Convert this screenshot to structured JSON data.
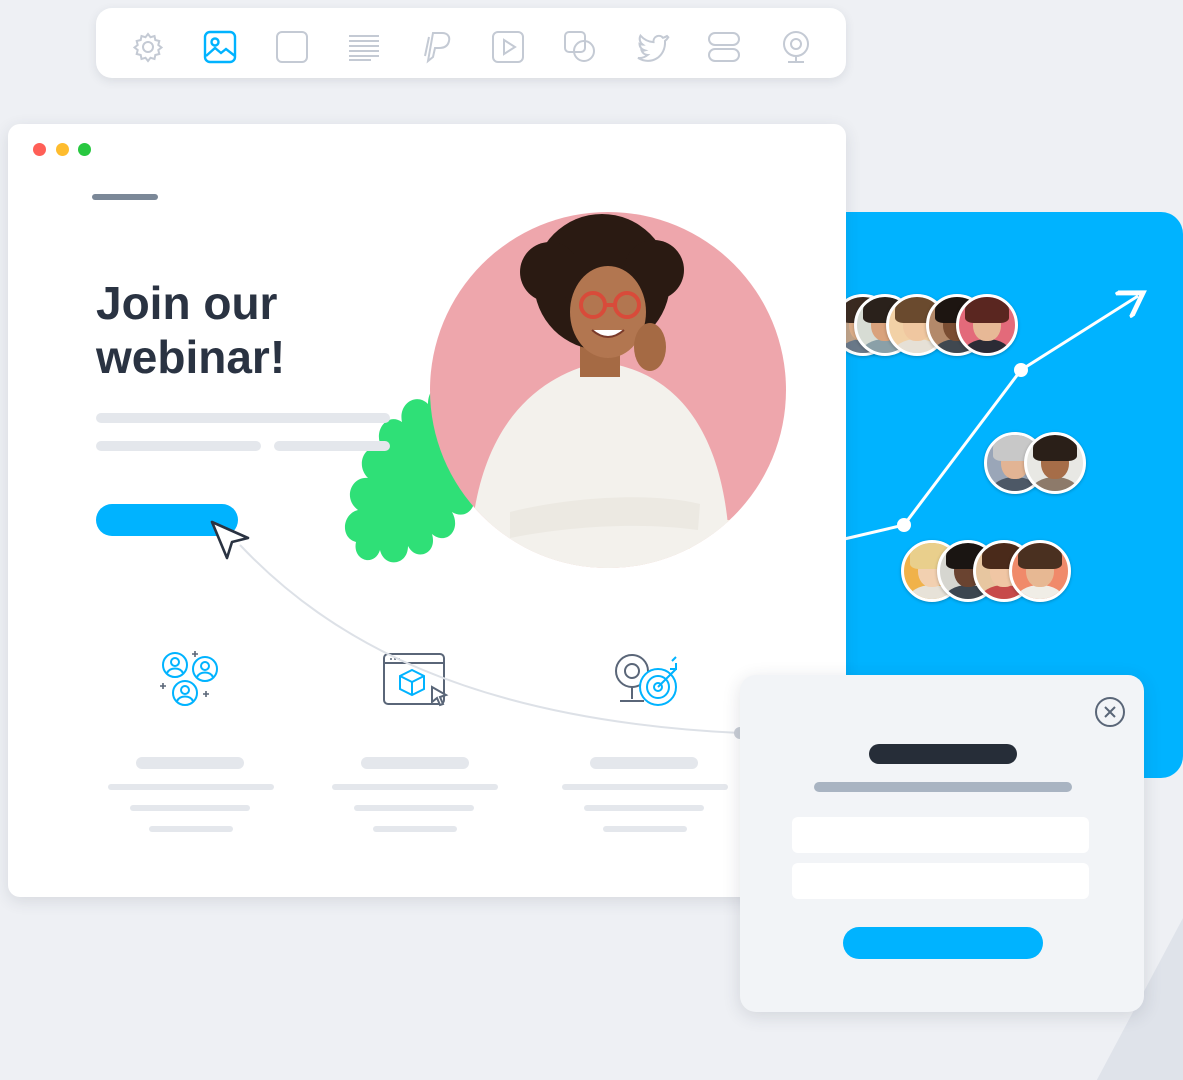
{
  "headline": {
    "line1": "Join our",
    "line2": "webinar!"
  },
  "toolbar": {
    "items": [
      {
        "icon": "settings-icon",
        "active": false
      },
      {
        "icon": "image-icon",
        "active": true
      },
      {
        "icon": "square-icon",
        "active": false
      },
      {
        "icon": "text-lines-icon",
        "active": false
      },
      {
        "icon": "paypal-icon",
        "active": false
      },
      {
        "icon": "video-play-icon",
        "active": false
      },
      {
        "icon": "shapes-icon",
        "active": false
      },
      {
        "icon": "twitter-icon",
        "active": false
      },
      {
        "icon": "layout-blocks-icon",
        "active": false
      },
      {
        "icon": "webcam-icon",
        "active": false
      }
    ]
  },
  "window_controls": {
    "close_color": "#ff5f57",
    "minimize_color": "#febc2e",
    "maximize_color": "#28c840"
  },
  "features": [
    {
      "icon": "users-group-icon"
    },
    {
      "icon": "3d-box-cursor-icon"
    },
    {
      "icon": "webcam-target-icon"
    }
  ],
  "colors": {
    "accent": "#00b3ff",
    "blob": "#2fe077",
    "photo_bg": "#eea6ac",
    "dark_text": "#2a3342",
    "icon_gray": "#c4cad4"
  }
}
